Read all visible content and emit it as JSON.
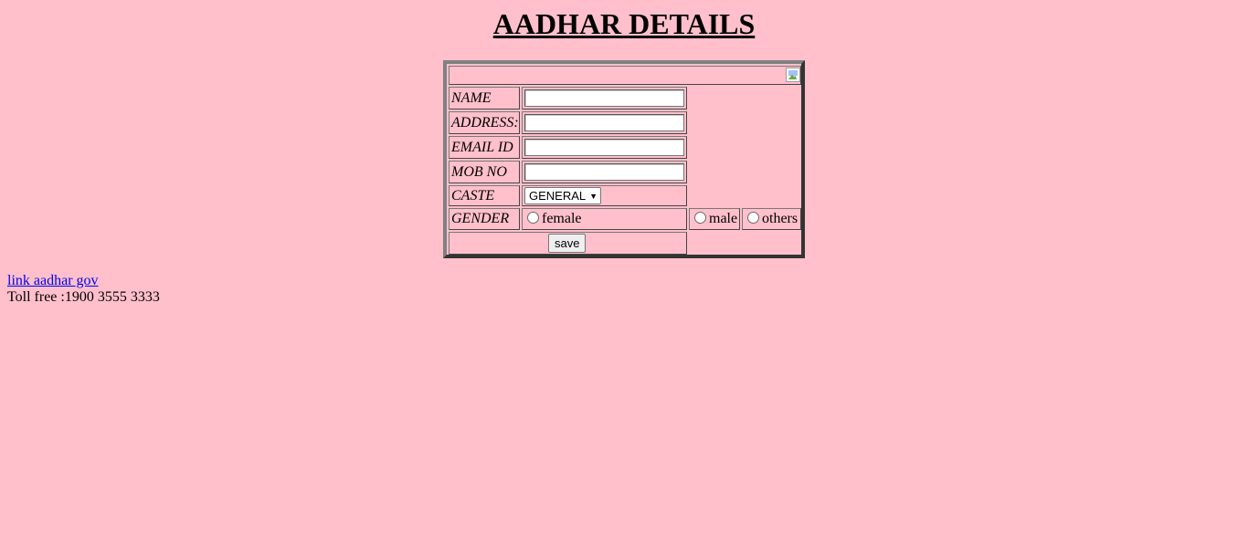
{
  "page": {
    "title": "AADHAR DETAILS"
  },
  "form": {
    "header_image": "broken-image-icon",
    "fields": {
      "name": {
        "label": "NAME",
        "value": ""
      },
      "address": {
        "label": "ADDRESS:",
        "value": ""
      },
      "email": {
        "label": "EMAIL ID",
        "value": ""
      },
      "mobile": {
        "label": "MOB NO",
        "value": ""
      }
    },
    "caste": {
      "label": "CASTE",
      "selected": "GENERAL"
    },
    "gender": {
      "label": "GENDER",
      "options": [
        "female",
        "male",
        "others"
      ]
    },
    "save_label": "save"
  },
  "footer": {
    "link_text": "link aadhar gov",
    "toll_free": "Toll free :1900 3555 3333"
  },
  "colors": {
    "background": "#ffc0cb",
    "link": "#0000ee"
  }
}
